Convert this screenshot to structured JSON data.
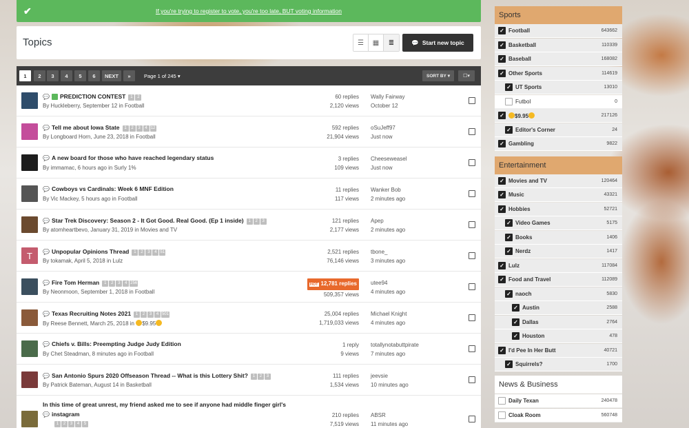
{
  "banner": {
    "message": "If you're trying to register to vote, you're too late, BUT voting information"
  },
  "header": {
    "title": "Topics",
    "start_label": "Start new topic"
  },
  "pager": {
    "pages": [
      "1",
      "2",
      "3",
      "4",
      "5",
      "6"
    ],
    "next": "NEXT",
    "last": "»",
    "page_of": "Page 1 of 245",
    "sort_by": "SORT BY"
  },
  "topics": [
    {
      "title": "PREDICTION CONTEST",
      "pages": [
        "1",
        "2"
      ],
      "author": "By Huckleberry, September 12 in Football",
      "replies": "60 replies",
      "views": "2,120 views",
      "last_user": "Wally Fairway",
      "last_time": "October 12",
      "avatar_color": "#2f4d6b",
      "avatar_letter": "",
      "pinned": true
    },
    {
      "title": "Tell me about Iowa State",
      "pages": [
        "1",
        "2",
        "3",
        "4",
        "12"
      ],
      "author": "By Longboard Horn, June 23, 2018 in Football",
      "replies": "592 replies",
      "views": "21,904 views",
      "last_user": "oSuJeff97",
      "last_time": "Just now",
      "avatar_color": "#c44d9b",
      "avatar_letter": ""
    },
    {
      "title": "A new board for those who have reached legendary status",
      "pages": [],
      "author": "By immamac, 6 hours ago in Surly 1%",
      "replies": "3 replies",
      "views": "109 views",
      "last_user": "Cheeseweasel",
      "last_time": "Just now",
      "avatar_color": "#1d1d1d",
      "avatar_letter": ""
    },
    {
      "title": "Cowboys vs Cardinals: Week 6 MNF Edition",
      "pages": [],
      "author": "By Vic Mackey, 5 hours ago in Football",
      "replies": "11 replies",
      "views": "117 views",
      "last_user": "Wanker Bob",
      "last_time": "2 minutes ago",
      "avatar_color": "#555555",
      "avatar_letter": ""
    },
    {
      "title": "Star Trek Discovery: Season 2 - It Got Good. Real Good. (Ep 1 inside)",
      "pages": [
        "1",
        "2",
        "3"
      ],
      "author": "By atomheartbevo, January 31, 2019 in Movies and TV",
      "replies": "121 replies",
      "views": "2,177 views",
      "last_user": "Apep",
      "last_time": "2 minutes ago",
      "avatar_color": "#6b4a2f",
      "avatar_letter": ""
    },
    {
      "title": "Unpopular Opinions Thread",
      "pages": [
        "1",
        "2",
        "3",
        "4",
        "51"
      ],
      "author": "By tokamak, April 5, 2018 in Lulz",
      "replies": "2,521 replies",
      "views": "76,146 views",
      "last_user": "tbone_",
      "last_time": "3 minutes ago",
      "avatar_color": "#c45c6e",
      "avatar_letter": "T"
    },
    {
      "title": "Fire Tom Herman",
      "pages": [
        "1",
        "2",
        "3",
        "4",
        "256"
      ],
      "author": "By Neonmoon, September 1, 2018 in Football",
      "replies": "12,781 replies",
      "views": "509,357 views",
      "last_user": "utee94",
      "last_time": "4 minutes ago",
      "avatar_color": "#3b4f5e",
      "avatar_letter": "",
      "hot": "HOT"
    },
    {
      "title": "Texas Recruiting Notes 2021",
      "pages": [
        "1",
        "2",
        "3",
        "4",
        "501"
      ],
      "author": "By Reese Bennett, March 25, 2018 in",
      "author_extra": "$9.95",
      "replies": "25,004 replies",
      "views": "1,719,033 views",
      "last_user": "Michael Knight",
      "last_time": "4 minutes ago",
      "avatar_color": "#8a5a3a",
      "avatar_letter": ""
    },
    {
      "title": "Chiefs v. Bills: Preempting Judge Judy Edition",
      "pages": [],
      "author": "By Chet Steadman, 8 minutes ago in Football",
      "replies": "1 reply",
      "views": "9 views",
      "last_user": "totallynotabuttpirate",
      "last_time": "7 minutes ago",
      "avatar_color": "#4a6b4a",
      "avatar_letter": ""
    },
    {
      "title": "San Antonio Spurs 2020 Offseason Thread -- What is this Lottery Shit?",
      "pages": [
        "1",
        "2",
        "3"
      ],
      "author": "By Patrick Bateman, August 14 in Basketball",
      "replies": "111 replies",
      "views": "1,534 views",
      "last_user": "jeevsie",
      "last_time": "10 minutes ago",
      "avatar_color": "#7a3a3a",
      "avatar_letter": ""
    },
    {
      "title_line1": "In this time of great unrest, my friend asked me to see if anyone had middle finger girl's",
      "title_line2": "instagram",
      "pages": [
        "1",
        "2",
        "3",
        "4",
        "5"
      ],
      "replies": "210 replies",
      "views": "7,519 views",
      "last_user": "ABSR",
      "last_time": "11 minutes ago",
      "avatar_color": "#7a6b3a",
      "avatar_letter": ""
    }
  ],
  "sidebar": {
    "sports": {
      "title": "Sports",
      "items": [
        {
          "label": "Football",
          "count": "643662"
        },
        {
          "label": "Basketball",
          "count": "110339"
        },
        {
          "label": "Baseball",
          "count": "168082"
        },
        {
          "label": "Other Sports",
          "count": "114619"
        },
        {
          "label": "UT Sports",
          "count": "13010"
        },
        {
          "label": "Futbol",
          "count": "0"
        },
        {
          "label": "$9.95",
          "count": "217126"
        },
        {
          "label": "Editor's Corner",
          "count": "24"
        },
        {
          "label": "Gambling",
          "count": "9822"
        }
      ]
    },
    "entertainment": {
      "title": "Entertainment",
      "items": [
        {
          "label": "Movies and TV",
          "count": "120464"
        },
        {
          "label": "Music",
          "count": "43321"
        },
        {
          "label": "Hobbies",
          "count": "52721"
        },
        {
          "label": "Video Games",
          "count": "5175"
        },
        {
          "label": "Books",
          "count": "1406"
        },
        {
          "label": "Nerdz",
          "count": "1417"
        },
        {
          "label": "Lulz",
          "count": "117084"
        },
        {
          "label": "Food and Travel",
          "count": "112089"
        },
        {
          "label": "naoch",
          "count": "5830"
        },
        {
          "label": "Austin",
          "count": "2588"
        },
        {
          "label": "Dallas",
          "count": "2764"
        },
        {
          "label": "Houston",
          "count": "478"
        },
        {
          "label": "I'd Pee In Her Butt",
          "count": "40721"
        },
        {
          "label": "Squirrels?",
          "count": "1700"
        }
      ]
    },
    "news": {
      "title": "News & Business",
      "items": [
        {
          "label": "Daily Texan",
          "count": "240478"
        },
        {
          "label": "Cloak Room",
          "count": "560748"
        }
      ]
    }
  },
  "colors": {
    "banner": "#5cb85c",
    "category_header": "#e0a86f",
    "hot": "#e8692c"
  }
}
